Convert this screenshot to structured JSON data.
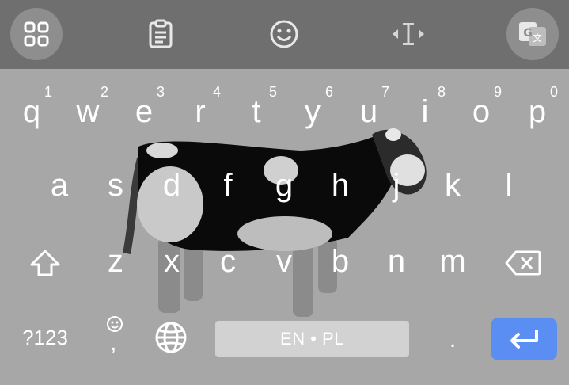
{
  "toolbar": {
    "items": [
      {
        "icon": "grid-icon"
      },
      {
        "icon": "clipboard-icon"
      },
      {
        "icon": "emoji-icon"
      },
      {
        "icon": "text-cursor-icon"
      },
      {
        "icon": "translate-icon"
      }
    ]
  },
  "keys": {
    "row1": [
      {
        "label": "q",
        "hint": "1"
      },
      {
        "label": "w",
        "hint": "2"
      },
      {
        "label": "e",
        "hint": "3"
      },
      {
        "label": "r",
        "hint": "4"
      },
      {
        "label": "t",
        "hint": "5"
      },
      {
        "label": "y",
        "hint": "6"
      },
      {
        "label": "u",
        "hint": "7"
      },
      {
        "label": "i",
        "hint": "8"
      },
      {
        "label": "o",
        "hint": "9"
      },
      {
        "label": "p",
        "hint": "0"
      }
    ],
    "row2": [
      "a",
      "s",
      "d",
      "f",
      "g",
      "h",
      "j",
      "k",
      "l"
    ],
    "row3": [
      "z",
      "x",
      "c",
      "v",
      "b",
      "n",
      "m"
    ],
    "symbols_label": "?123",
    "comma_label": ",",
    "space_label": "EN • PL",
    "period_label": "."
  },
  "icons": {
    "shift": "shift-icon",
    "backspace": "backspace-icon",
    "emoji_small": "emoji-small-icon",
    "globe": "globe-icon",
    "enter": "enter-icon"
  },
  "colors": {
    "keyboard_bg": "#a7a7a7",
    "toolbar_bg": "#6f6f6f",
    "enter_key": "#5b8ef3",
    "space_key": "#d2d2d2"
  }
}
